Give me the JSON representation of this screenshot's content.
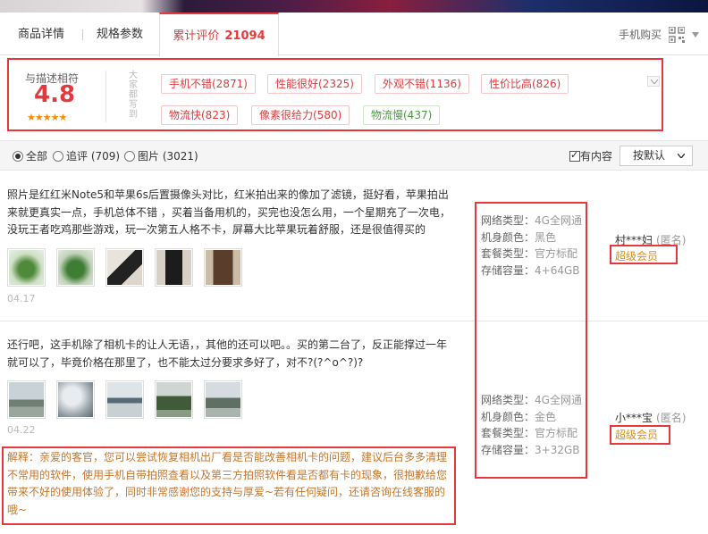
{
  "tabs": {
    "detail": "商品详情",
    "specs": "规格参数",
    "reviews_label": "累计评价",
    "reviews_count": "21094",
    "mobile_buy": "手机购买"
  },
  "summary": {
    "rate_label": "与描述相符",
    "rate_score": "4.8",
    "stars": "★★★★★",
    "all_say": "大家都写到",
    "tags": [
      {
        "text": "手机不错(2871)",
        "type": "pos"
      },
      {
        "text": "性能很好(2325)",
        "type": "pos"
      },
      {
        "text": "外观不错(1136)",
        "type": "pos"
      },
      {
        "text": "性价比高(826)",
        "type": "pos"
      },
      {
        "text": "物流快(823)",
        "type": "pos"
      },
      {
        "text": "像素很给力(580)",
        "type": "pos"
      },
      {
        "text": "物流慢(437)",
        "type": "neg"
      }
    ]
  },
  "filter": {
    "all": "全部",
    "followup": "追评 (709)",
    "pictures": "图片 (3021)",
    "has_content": "有内容",
    "sort": "按默认"
  },
  "reviews": [
    {
      "text": "照片是红红米Note5和苹果6s后置摄像头对比，红米拍出来的像加了滤镜，挺好看，苹果拍出来就更真实一点，手机总体不错 ，买着当备用机的，买完也没怎么用，一个星期充了一次电，没玩王者吃鸡那些游戏，玩一次第五人格不卡，屏幕大比苹果玩着舒服，还是很值得买的",
      "date": "04.17",
      "network_k": "网络类型：",
      "network_v": "4G全网通",
      "color_k": "机身颜色：",
      "color_v": "黑色",
      "package_k": "套餐类型：",
      "package_v": "官方标配",
      "storage_k": "存储容量：",
      "storage_v": "4+64GB",
      "user": "村***妇",
      "anon": "(匿名)",
      "level": "超级会员"
    },
    {
      "text": "还行吧，这手机除了相机卡的让人无语，，其他的还可以吧。。买的第二台了，反正能撑过一年就可以了，毕竟价格在那里了，也不能太过分要求多好了，对不?(?^o^?)?",
      "date": "04.22",
      "network_k": "网络类型：",
      "network_v": "4G全网通",
      "color_k": "机身颜色：",
      "color_v": "金色",
      "package_k": "套餐类型：",
      "package_v": "官方标配",
      "storage_k": "存储容量：",
      "storage_v": "3+32GB",
      "user": "小***宝",
      "anon": "(匿名)",
      "level": "超级会员",
      "reply": "解释：亲爱的客官，您可以尝试恢复相机出厂看是否能改善相机卡的问题，建议后台多多清理不常用的软件，使用手机自带拍照查看以及第三方拍照软件看是否都有卡的现象，很抱歉给您带来不好的使用体验了，同时非常感谢您的支持与厚爱~若有任何疑问，还请咨询在线客服的哦~"
    }
  ],
  "colors": {
    "accent": "#e4393c",
    "vip": "#e38d13",
    "reply": "#c6762b",
    "star": "#ff8a00"
  }
}
